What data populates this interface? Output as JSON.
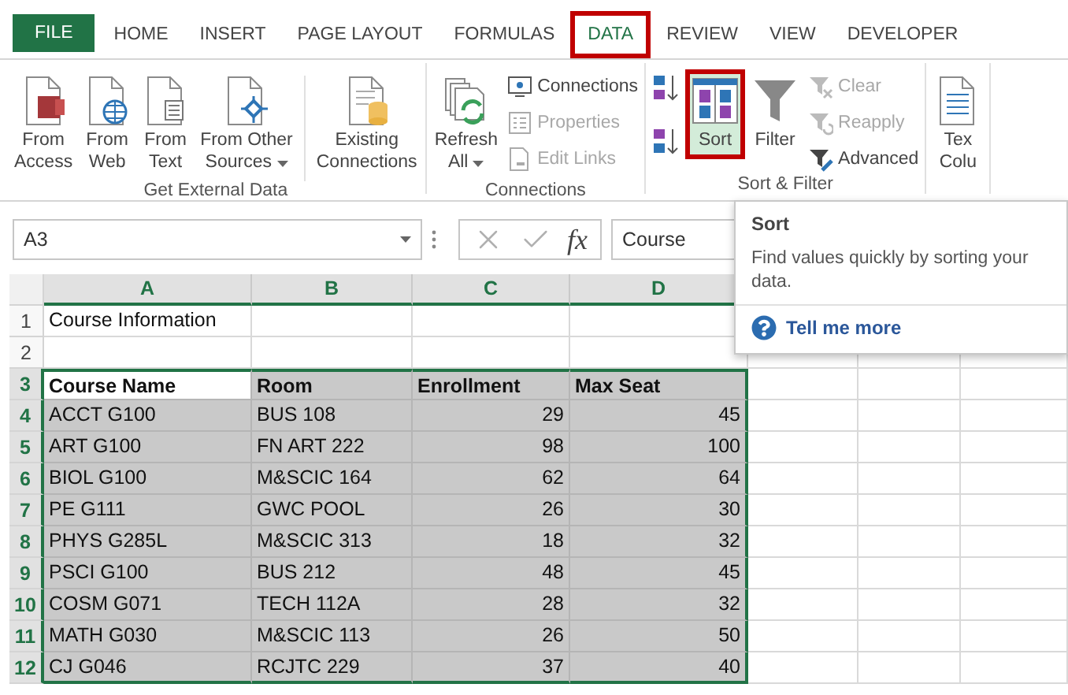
{
  "tabs": [
    {
      "label": "FILE",
      "kind": "file",
      "selected": false,
      "highlighted": false
    },
    {
      "label": "HOME",
      "kind": "tab",
      "selected": false,
      "highlighted": false
    },
    {
      "label": "INSERT",
      "kind": "tab",
      "selected": false,
      "highlighted": false
    },
    {
      "label": "PAGE LAYOUT",
      "kind": "tab",
      "selected": false,
      "highlighted": false
    },
    {
      "label": "FORMULAS",
      "kind": "tab",
      "selected": false,
      "highlighted": false
    },
    {
      "label": "DATA",
      "kind": "tab",
      "selected": true,
      "highlighted": true
    },
    {
      "label": "REVIEW",
      "kind": "tab",
      "selected": false,
      "highlighted": false
    },
    {
      "label": "VIEW",
      "kind": "tab",
      "selected": false,
      "highlighted": false
    },
    {
      "label": "DEVELOPER",
      "kind": "tab",
      "selected": false,
      "highlighted": false
    }
  ],
  "ribbon": {
    "groups": [
      {
        "label": "Get External Data",
        "items": [
          {
            "kind": "large",
            "lines": [
              "From",
              "Access"
            ],
            "dropdown": false,
            "disabled": false,
            "selected": false,
            "highlighted": false
          },
          {
            "kind": "large",
            "lines": [
              "From",
              "Web"
            ],
            "dropdown": false,
            "disabled": false,
            "selected": false,
            "highlighted": false
          },
          {
            "kind": "large",
            "lines": [
              "From",
              "Text"
            ],
            "dropdown": false,
            "disabled": false,
            "selected": false,
            "highlighted": false
          },
          {
            "kind": "large",
            "lines": [
              "From Other",
              "Sources"
            ],
            "dropdown": true,
            "disabled": false,
            "selected": false,
            "highlighted": false
          },
          {
            "kind": "separator"
          },
          {
            "kind": "large",
            "lines": [
              "Existing",
              "Connections"
            ],
            "dropdown": false,
            "disabled": false,
            "selected": false,
            "highlighted": false
          }
        ]
      },
      {
        "label": "Connections",
        "items": [
          {
            "kind": "large",
            "lines": [
              "Refresh",
              "All"
            ],
            "dropdown": true,
            "disabled": false,
            "selected": false,
            "highlighted": false
          },
          {
            "kind": "small",
            "label": "Connections",
            "disabled": false
          },
          {
            "kind": "small",
            "label": "Properties",
            "disabled": true
          },
          {
            "kind": "small",
            "label": "Edit Links",
            "disabled": true
          }
        ]
      },
      {
        "label": "Sort & Filter",
        "items": [
          {
            "kind": "sort-ascending"
          },
          {
            "kind": "sort-descending"
          },
          {
            "kind": "large",
            "lines": [
              "Sort"
            ],
            "dropdown": false,
            "disabled": false,
            "selected": true,
            "highlighted": true
          },
          {
            "kind": "large",
            "lines": [
              "Filter"
            ],
            "dropdown": false,
            "disabled": false,
            "selected": false,
            "highlighted": false
          },
          {
            "kind": "small",
            "label": "Clear",
            "disabled": true
          },
          {
            "kind": "small",
            "label": "Reapply",
            "disabled": true
          },
          {
            "kind": "small",
            "label": "Advanced",
            "disabled": false
          }
        ]
      },
      {
        "items": [
          {
            "kind": "large",
            "lines": [
              "Tex",
              "Colu"
            ],
            "dropdown": false,
            "disabled": false,
            "selected": false,
            "highlighted": false
          }
        ]
      }
    ]
  },
  "formula_bar": {
    "name_box": "A3",
    "function_label": "fx",
    "formula": "Course"
  },
  "sheet": {
    "columns": [
      {
        "label": "A",
        "selected": true,
        "numeric": false
      },
      {
        "label": "B",
        "selected": true,
        "numeric": false
      },
      {
        "label": "C",
        "selected": true,
        "numeric": true
      },
      {
        "label": "D",
        "selected": true,
        "numeric": true
      }
    ],
    "rows": [
      {
        "number": "1",
        "selected": false,
        "kind": "data",
        "cells": [
          {
            "text": "Course Information",
            "active": false
          }
        ]
      },
      {
        "number": "2",
        "selected": false,
        "kind": "data"
      },
      {
        "number": "3",
        "selected": true,
        "kind": "header",
        "cells": [
          {
            "text": "Course Name",
            "active": true
          },
          {
            "text": "Room",
            "active": false
          },
          {
            "text": "Enrollment",
            "active": false
          },
          {
            "text": "Max Seat",
            "active": false
          }
        ]
      },
      {
        "number": "4",
        "selected": true,
        "kind": "data",
        "cells": [
          {
            "text": "ACCT G100",
            "active": false
          },
          {
            "text": "BUS 108",
            "active": false
          },
          {
            "text": "29",
            "active": false
          },
          {
            "text": "45",
            "active": false
          }
        ]
      },
      {
        "number": "5",
        "selected": true,
        "kind": "data",
        "cells": [
          {
            "text": "ART G100",
            "active": false
          },
          {
            "text": "FN ART 222",
            "active": false
          },
          {
            "text": "98",
            "active": false
          },
          {
            "text": "100",
            "active": false
          }
        ]
      },
      {
        "number": "6",
        "selected": true,
        "kind": "data",
        "cells": [
          {
            "text": "BIOL G100",
            "active": false
          },
          {
            "text": "M&SCIC 164",
            "active": false
          },
          {
            "text": "62",
            "active": false
          },
          {
            "text": "64",
            "active": false
          }
        ]
      },
      {
        "number": "7",
        "selected": true,
        "kind": "data",
        "cells": [
          {
            "text": "PE G111",
            "active": false
          },
          {
            "text": "GWC POOL",
            "active": false
          },
          {
            "text": "26",
            "active": false
          },
          {
            "text": "30",
            "active": false
          }
        ]
      },
      {
        "number": "8",
        "selected": true,
        "kind": "data",
        "cells": [
          {
            "text": "PHYS G285L",
            "active": false
          },
          {
            "text": "M&SCIC 313",
            "active": false
          },
          {
            "text": "18",
            "active": false
          },
          {
            "text": "32",
            "active": false
          }
        ]
      },
      {
        "number": "9",
        "selected": true,
        "kind": "data",
        "cells": [
          {
            "text": "PSCI G100",
            "active": false
          },
          {
            "text": "BUS 212",
            "active": false
          },
          {
            "text": "48",
            "active": false
          },
          {
            "text": "45",
            "active": false
          }
        ]
      },
      {
        "number": "10",
        "selected": true,
        "kind": "data",
        "cells": [
          {
            "text": "COSM G071",
            "active": false
          },
          {
            "text": "TECH 112A",
            "active": false
          },
          {
            "text": "28",
            "active": false
          },
          {
            "text": "32",
            "active": false
          }
        ]
      },
      {
        "number": "11",
        "selected": true,
        "kind": "data",
        "cells": [
          {
            "text": "MATH G030",
            "active": false
          },
          {
            "text": "M&SCIC 113",
            "active": false
          },
          {
            "text": "26",
            "active": false
          },
          {
            "text": "50",
            "active": false
          }
        ]
      },
      {
        "number": "12",
        "selected": true,
        "kind": "data",
        "cells": [
          {
            "text": "CJ G046",
            "active": false
          },
          {
            "text": "RCJTC 229",
            "active": false
          },
          {
            "text": "37",
            "active": false
          },
          {
            "text": "40",
            "active": false
          }
        ]
      }
    ]
  },
  "tooltip": {
    "title": "Sort",
    "body": "Find values quickly by sorting your data.",
    "link": "Tell me more"
  }
}
